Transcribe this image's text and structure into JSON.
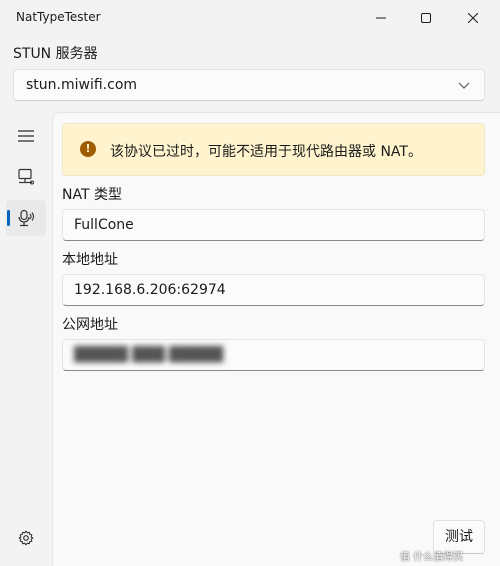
{
  "window": {
    "title": "NatTypeTester",
    "controls": [
      "minimize-icon",
      "maximize-icon",
      "close-icon"
    ]
  },
  "stun": {
    "label": "STUN 服务器",
    "server": "stun.miwifi.com"
  },
  "nav": {
    "items": [
      {
        "icon": "hamburger-menu-icon"
      },
      {
        "icon": "network-icon"
      },
      {
        "icon": "microphone-test-icon",
        "selected": true
      }
    ],
    "settings_icon": "gear-icon",
    "accent_color": "#0067c0"
  },
  "warning": {
    "icon": "warning-icon",
    "text": "该协议已过时，可能不适用于现代路由器或 NAT。",
    "background": "#fff4ce"
  },
  "results": {
    "nat_type_label": "NAT 类型",
    "nat_type_value": "FullCone",
    "local_label": "本地地址",
    "local_value": "192.168.6.206:62974",
    "public_label": "公网地址",
    "public_value": "█████ ███:█████"
  },
  "actions": {
    "test_label": "测试"
  },
  "watermark": {
    "text": "值 什么值得买"
  }
}
